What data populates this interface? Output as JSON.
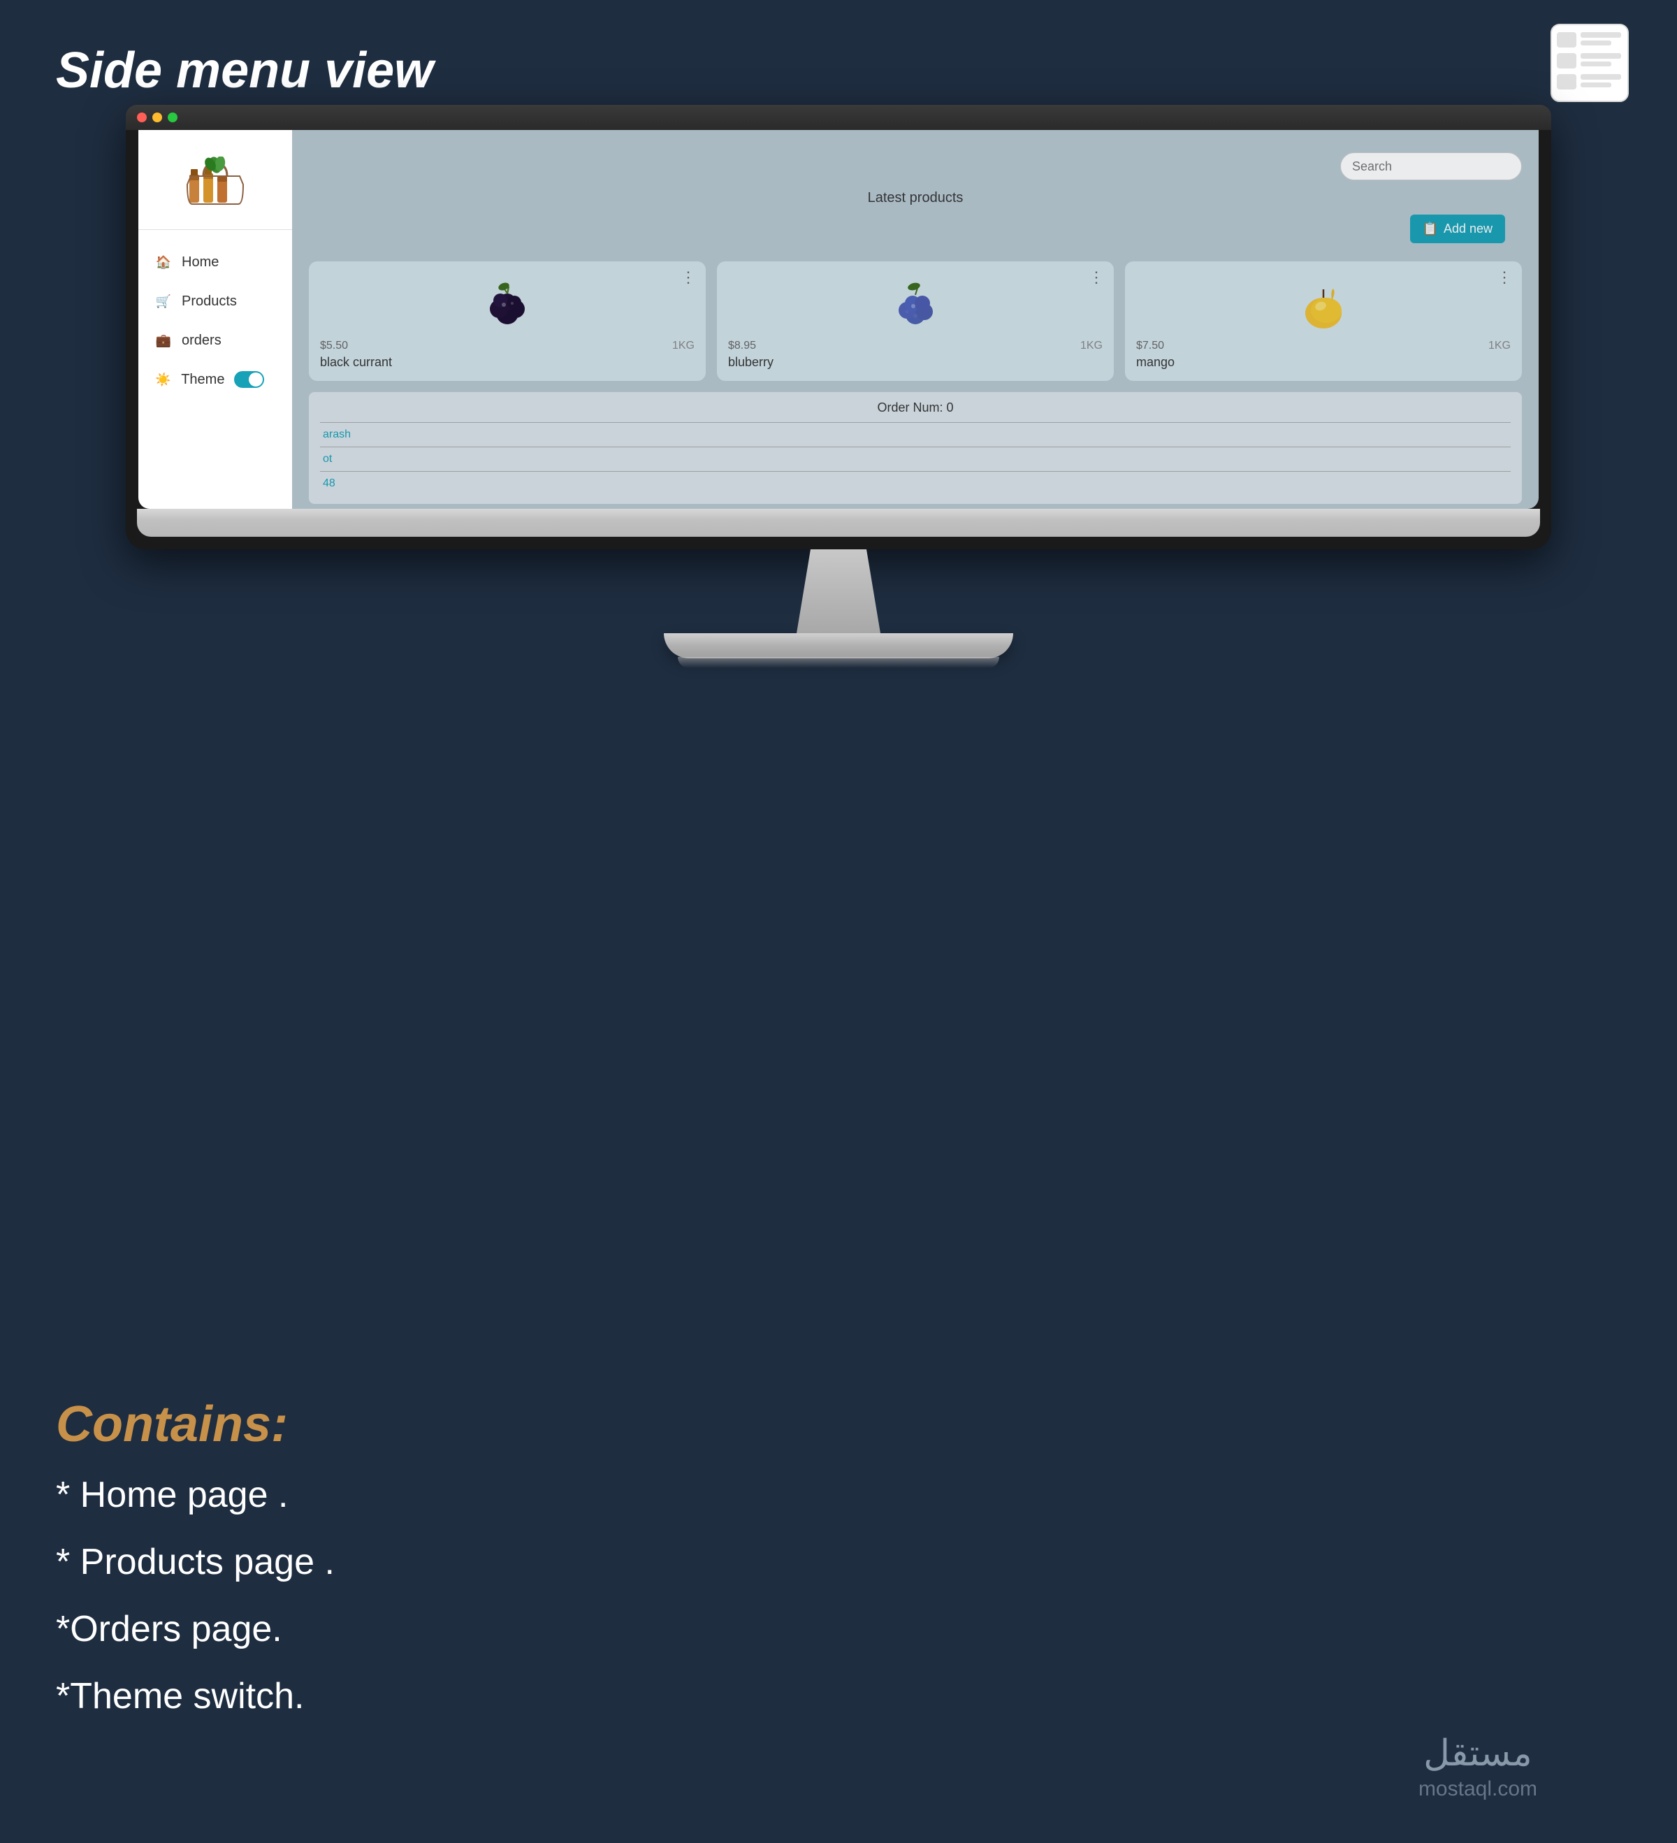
{
  "page": {
    "title": "Side menu view",
    "background_color": "#1e2d40"
  },
  "header": {
    "search_placeholder": "Search",
    "search_label": "Search"
  },
  "sidebar": {
    "nav_items": [
      {
        "id": "home",
        "label": "Home",
        "icon": "home"
      },
      {
        "id": "products",
        "label": "Products",
        "icon": "shopping-cart"
      },
      {
        "id": "orders",
        "label": "orders",
        "icon": "briefcase"
      },
      {
        "id": "theme",
        "label": "Theme",
        "icon": "sun",
        "has_toggle": true
      }
    ]
  },
  "main": {
    "latest_products_label": "Latest products",
    "add_new_label": "Add new",
    "products": [
      {
        "name": "black currant",
        "price": "$5.50",
        "weight": "1KG",
        "color": "#c0d8e0"
      },
      {
        "name": "bluberry",
        "price": "$8.95",
        "weight": "1KG",
        "color": "#c0d8e0"
      },
      {
        "name": "mango",
        "price": "$7.50",
        "weight": "1KG",
        "color": "#c0d8e0"
      }
    ],
    "orders_section": {
      "title": "Order Num: 0",
      "rows": [
        "arash",
        "ot",
        "48"
      ]
    }
  },
  "contains": {
    "title": "Contains:",
    "items": [
      "* Home page .",
      "* Products page .",
      "*Orders page.",
      "*Theme switch."
    ]
  },
  "mostaql": {
    "text": "مستقل",
    "url": "mostaql.com"
  }
}
